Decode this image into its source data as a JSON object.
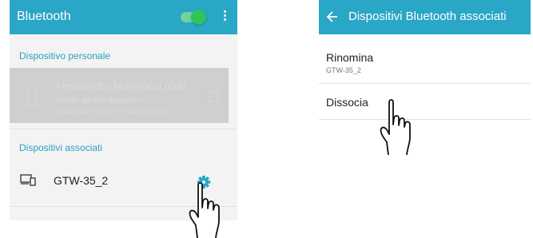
{
  "left_screen": {
    "appbar": {
      "title": "Bluetooth",
      "toggle_state": "on",
      "toggle_color": "#2fc45e"
    },
    "personal_section": {
      "header": "Dispositivo personale",
      "device_name": "Alessandro Mannocci (Gal",
      "line1": "Visibile ad altri dispositivi",
      "line2": "Tocca per rendere visibile a tutti"
    },
    "associated_section": {
      "header": "Dispositivi associati",
      "devices": [
        {
          "name": "GTW-35_2",
          "icon": "devices-icon",
          "action_icon": "gear-icon"
        }
      ]
    }
  },
  "right_screen": {
    "appbar": {
      "title": "Dispositivi Bluetooth associati",
      "back_icon": "back-arrow-icon"
    },
    "options": [
      {
        "label": "Rinomina",
        "sublabel": "GTW-35_2"
      },
      {
        "label": "Dissocia"
      }
    ]
  },
  "colors": {
    "accent": "#2aa6c6",
    "section_text": "#2c9fbf",
    "background": "#f3f3f3"
  }
}
